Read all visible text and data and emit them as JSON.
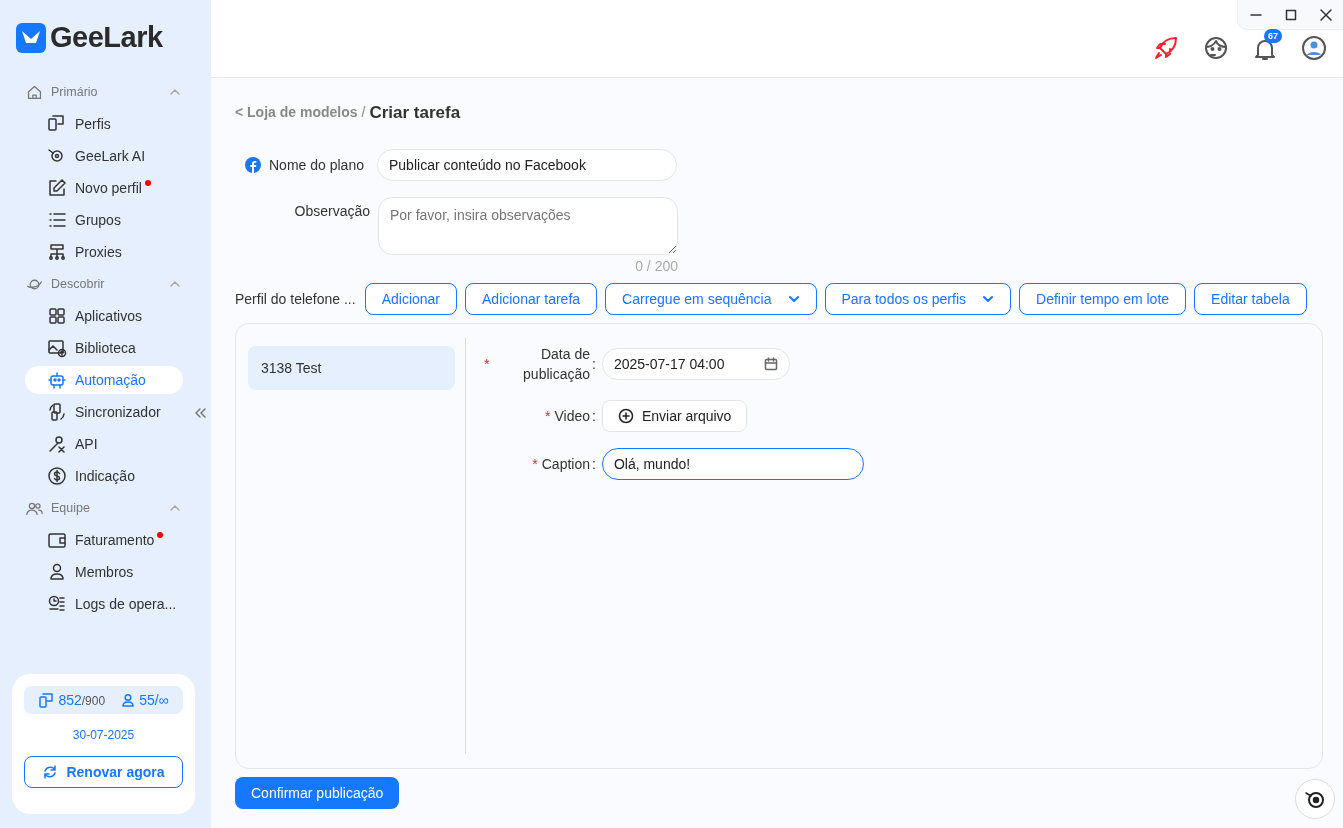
{
  "app": {
    "logo": "GeeLark"
  },
  "sidebar": {
    "sections": [
      {
        "title": "Primário",
        "expanded": true,
        "items": [
          {
            "label": "Perfis",
            "selected": false,
            "dot": false
          },
          {
            "label": "GeeLark AI",
            "selected": false,
            "dot": false
          },
          {
            "label": "Novo perfil",
            "selected": false,
            "dot": true
          },
          {
            "label": "Grupos",
            "selected": false,
            "dot": false
          },
          {
            "label": "Proxies",
            "selected": false,
            "dot": false
          }
        ]
      },
      {
        "title": "Descobrir",
        "expanded": true,
        "items": [
          {
            "label": "Aplicativos",
            "selected": false,
            "dot": false
          },
          {
            "label": "Biblioteca",
            "selected": false,
            "dot": false
          },
          {
            "label": "Automação",
            "selected": true,
            "dot": false
          },
          {
            "label": "Sincronizador",
            "selected": false,
            "dot": false
          },
          {
            "label": "API",
            "selected": false,
            "dot": false
          },
          {
            "label": "Indicação",
            "selected": false,
            "dot": false
          }
        ]
      },
      {
        "title": "Equipe",
        "expanded": true,
        "items": [
          {
            "label": "Faturamento",
            "selected": false,
            "dot": true
          },
          {
            "label": "Membros",
            "selected": false,
            "dot": false
          },
          {
            "label": "Logs de opera...",
            "selected": false,
            "dot": false
          }
        ]
      }
    ],
    "plan": {
      "profiles": "852",
      "profiles_limit": "/900",
      "members": "55/∞",
      "date": "30-07-2025",
      "renew_button": "Renovar agora"
    }
  },
  "header": {
    "notifications": "67"
  },
  "breadcrumb": {
    "back": "< Loja de modelos",
    "separator": "/",
    "current": "Criar tarefa"
  },
  "form": {
    "plan_name": {
      "label": "Nome do plano",
      "value": "Publicar conteúdo no Facebook"
    },
    "observation": {
      "label": "Observação",
      "placeholder": "Por favor, insira observações",
      "counter": "0 / 200"
    }
  },
  "toolbar": {
    "label": "Perfil do telefone ...",
    "buttons": [
      {
        "label": "Adicionar",
        "kind": "plain"
      },
      {
        "label": "Adicionar tarefa",
        "kind": "plain"
      },
      {
        "label": "Carregue em sequência",
        "kind": "dropdown"
      },
      {
        "label": "Para todos os perfis",
        "kind": "dropdown"
      },
      {
        "label": "Definir tempo em lote",
        "kind": "plain"
      },
      {
        "label": "Editar tabela",
        "kind": "plain"
      }
    ]
  },
  "profiles": [
    {
      "label": "3138 Test",
      "selected": true
    }
  ],
  "fields": [
    {
      "kind": "date",
      "required_mark": "*",
      "label": "Data de publicação",
      "colon": ":",
      "value": "2025-07-17 04:00"
    },
    {
      "kind": "upload",
      "required_mark": "*",
      "label": "Video",
      "colon": ":",
      "button": "Enviar arquivo"
    },
    {
      "kind": "text",
      "required_mark": "*",
      "label": "Caption",
      "colon": ":",
      "value": "Olá, mundo!",
      "focused": true
    }
  ],
  "confirm_button": "Confirmar publicação"
}
